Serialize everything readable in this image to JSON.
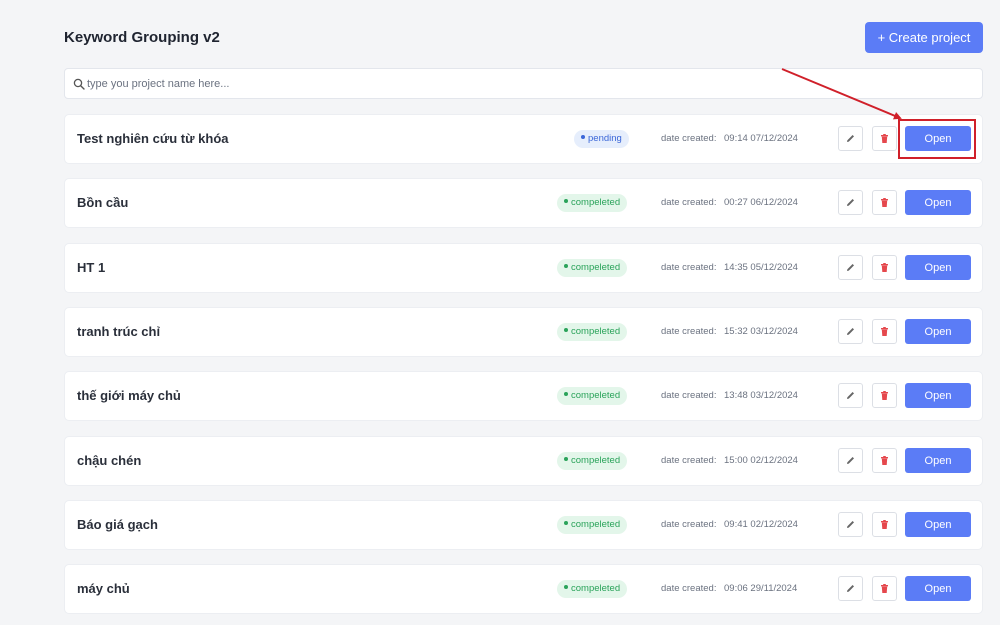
{
  "header": {
    "title": "Keyword Grouping v2",
    "create_label": "+ Create project"
  },
  "search": {
    "placeholder": "type you project name here...",
    "value": ""
  },
  "date_label": "date created:",
  "projects": [
    {
      "name": "Test nghiên cứu từ khóa",
      "status": "pending",
      "date": "09:14 07/12/2024",
      "open_label": "Open"
    },
    {
      "name": "Bồn cầu",
      "status": "compeleted",
      "date": "00:27 06/12/2024",
      "open_label": "Open"
    },
    {
      "name": "HT 1",
      "status": "compeleted",
      "date": "14:35 05/12/2024",
      "open_label": "Open"
    },
    {
      "name": "tranh trúc chỉ",
      "status": "compeleted",
      "date": "15:32 03/12/2024",
      "open_label": "Open"
    },
    {
      "name": "thế giới máy chủ",
      "status": "compeleted",
      "date": "13:48 03/12/2024",
      "open_label": "Open"
    },
    {
      "name": "chậu chén",
      "status": "compeleted",
      "date": "15:00 02/12/2024",
      "open_label": "Open"
    },
    {
      "name": "Báo giá gạch",
      "status": "compeleted",
      "date": "09:41 02/12/2024",
      "open_label": "Open"
    },
    {
      "name": "máy chủ",
      "status": "compeleted",
      "date": "09:06 29/11/2024",
      "open_label": "Open"
    }
  ],
  "colors": {
    "accent": "#5b7cf6",
    "pending_bg": "#e6eefc",
    "pending_text": "#3b67d8",
    "completed_bg": "#e3f6ea",
    "completed_text": "#2aa35a",
    "delete_icon": "#e5484d",
    "annotation": "#d0202a"
  },
  "icons": {
    "search": "search-icon",
    "edit": "pencil-icon",
    "delete": "trash-icon"
  }
}
